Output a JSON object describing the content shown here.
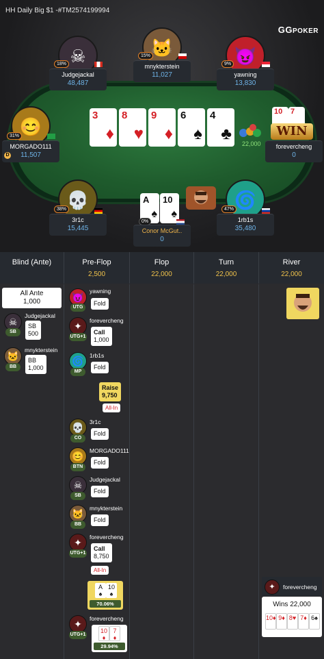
{
  "header": {
    "title": "HH Daily Big $1 -#TM2574199994",
    "logo_prefix": "GG",
    "logo_suffix": "POKER"
  },
  "table": {
    "pot": "22,000",
    "players": [
      {
        "name": "Judgejackal",
        "stack": "48,487",
        "pct": "18%",
        "avatar": "☠"
      },
      {
        "name": "mnykterstein",
        "stack": "11,027",
        "pct": "15%",
        "avatar": "🐱"
      },
      {
        "name": "yawning",
        "stack": "13,830",
        "pct": "9%",
        "avatar": "😈"
      },
      {
        "name": "MORGADO111",
        "stack": "11,507",
        "pct": "31%",
        "avatar": "😊"
      },
      {
        "name": "forevercheng",
        "stack": "0",
        "pct": "",
        "avatar": ""
      },
      {
        "name": "3r1c",
        "stack": "15,445",
        "pct": "38%",
        "avatar": "💀"
      },
      {
        "name": "Conor McGut..",
        "stack": "0",
        "pct": "0%",
        "avatar": ""
      },
      {
        "name": "1rb1s",
        "stack": "35,480",
        "pct": "47%",
        "avatar": "🌀"
      }
    ],
    "board": [
      {
        "rank": "3",
        "suit": "♦",
        "color": "#d41f25"
      },
      {
        "rank": "8",
        "suit": "♥",
        "color": "#d41f25"
      },
      {
        "rank": "9",
        "suit": "♦",
        "color": "#d41f25"
      },
      {
        "rank": "6",
        "suit": "♠",
        "color": "#111111"
      },
      {
        "rank": "4",
        "suit": "♣",
        "color": "#111111"
      }
    ],
    "hero_cards": [
      {
        "rank": "A",
        "suit": "♠"
      },
      {
        "rank": "10",
        "suit": "♠"
      }
    ],
    "winner_cards": [
      {
        "rank": "10",
        "suit": "♦"
      },
      {
        "rank": "7",
        "suit": "♦"
      }
    ],
    "win_badge": "WIN",
    "dealer_label": "D"
  },
  "columns": [
    {
      "title": "Blind (Ante)",
      "value": ""
    },
    {
      "title": "Pre-Flop",
      "value": "2,500"
    },
    {
      "title": "Flop",
      "value": "22,000"
    },
    {
      "title": "Turn",
      "value": "22,000"
    },
    {
      "title": "River",
      "value": "22,000"
    }
  ],
  "blind": {
    "ante_label": "All Ante",
    "ante_value": "1,000",
    "sb": {
      "name": "Judgejackal",
      "pos": "SB",
      "act": "SB",
      "amt": "500"
    },
    "bb": {
      "name": "mnykterstein",
      "pos": "BB",
      "act": "BB",
      "amt": "1,000"
    }
  },
  "preflop": [
    {
      "name": "yawning",
      "pos": "UTG",
      "act": "Fold",
      "amt": ""
    },
    {
      "name": "forevercheng",
      "pos": "UTG+1",
      "act": "Call",
      "amt": "1,000"
    },
    {
      "name": "1rb1s",
      "pos": "MP",
      "act": "Fold",
      "amt": ""
    },
    {
      "name": "",
      "pos": "",
      "act": "Raise",
      "amt": "9,750"
    },
    {
      "name": "3r1c",
      "pos": "CO",
      "act": "Fold",
      "amt": ""
    },
    {
      "name": "MORGADO111",
      "pos": "BTN",
      "act": "Fold",
      "amt": ""
    },
    {
      "name": "Judgejackal",
      "pos": "SB",
      "act": "Fold",
      "amt": ""
    },
    {
      "name": "mnykterstein",
      "pos": "BB",
      "act": "Fold",
      "amt": ""
    },
    {
      "name": "forevercheng",
      "pos": "UTG+1",
      "act": "Call",
      "amt": "8,750"
    }
  ],
  "allin_label": "All-In",
  "equity": {
    "hero": "70.06%",
    "villain": "29.94%",
    "villain_name": "forevercheng",
    "villain_pos": "UTG+1"
  },
  "river": {
    "winner": "forevercheng",
    "wins": "Wins 22,000",
    "cards": [
      "10♦",
      "9♦",
      "8♥",
      "7♦",
      "6♠"
    ]
  }
}
